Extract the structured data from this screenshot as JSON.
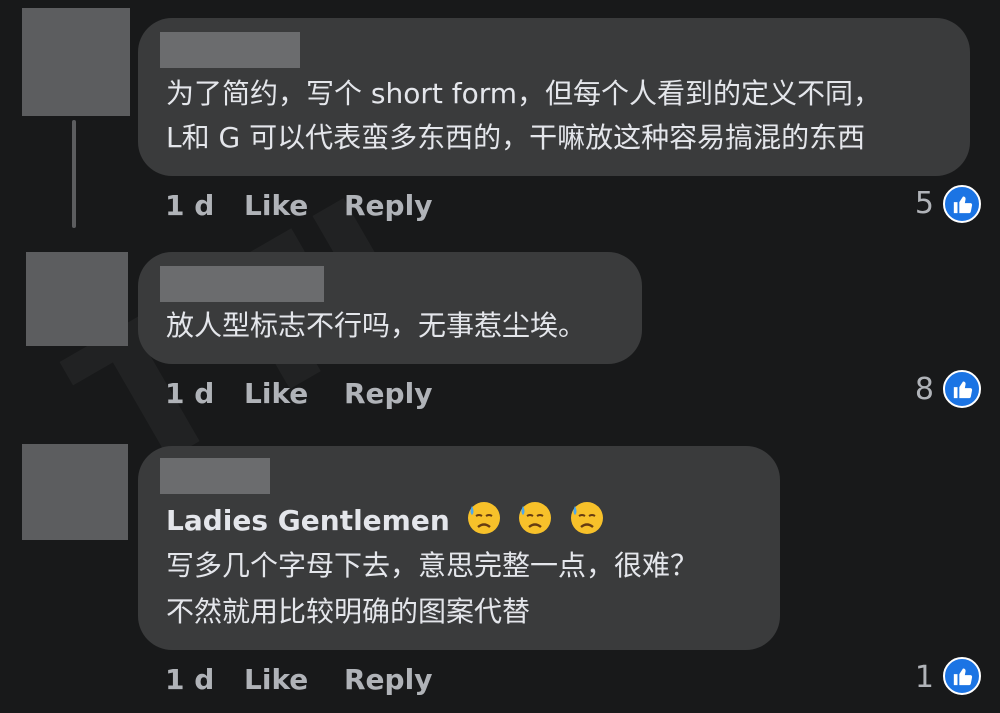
{
  "watermark": "TTI",
  "comments": [
    {
      "lines": [
        "为了简约，写个 short form，但每个人看到的定义不同，",
        "L和 G 可以代表蛮多东西的，干嘛放这种容易搞混的东西"
      ],
      "time": "1 d",
      "like_label": "Like",
      "reply_label": "Reply",
      "reactions": "5"
    },
    {
      "lines": [
        "放人型标志不行吗，无事惹尘埃。"
      ],
      "time": "1 d",
      "like_label": "Like",
      "reply_label": "Reply",
      "reactions": "8"
    },
    {
      "title": "Ladies Gentlemen",
      "lines": [
        "写多几个字母下去，意思完整一点，很难？",
        "不然就用比较明确的图案代替"
      ],
      "emojis": [
        "downcast-face-with-sweat",
        "downcast-face-with-sweat",
        "downcast-face-with-sweat"
      ],
      "time": "1 d",
      "like_label": "Like",
      "reply_label": "Reply",
      "reactions": "1"
    }
  ],
  "colors": {
    "background": "#18191a",
    "bubble": "#3a3b3c",
    "text": "#e4e6eb",
    "secondary_text": "#b0b3b8",
    "like_blue": "#1b74e4"
  }
}
